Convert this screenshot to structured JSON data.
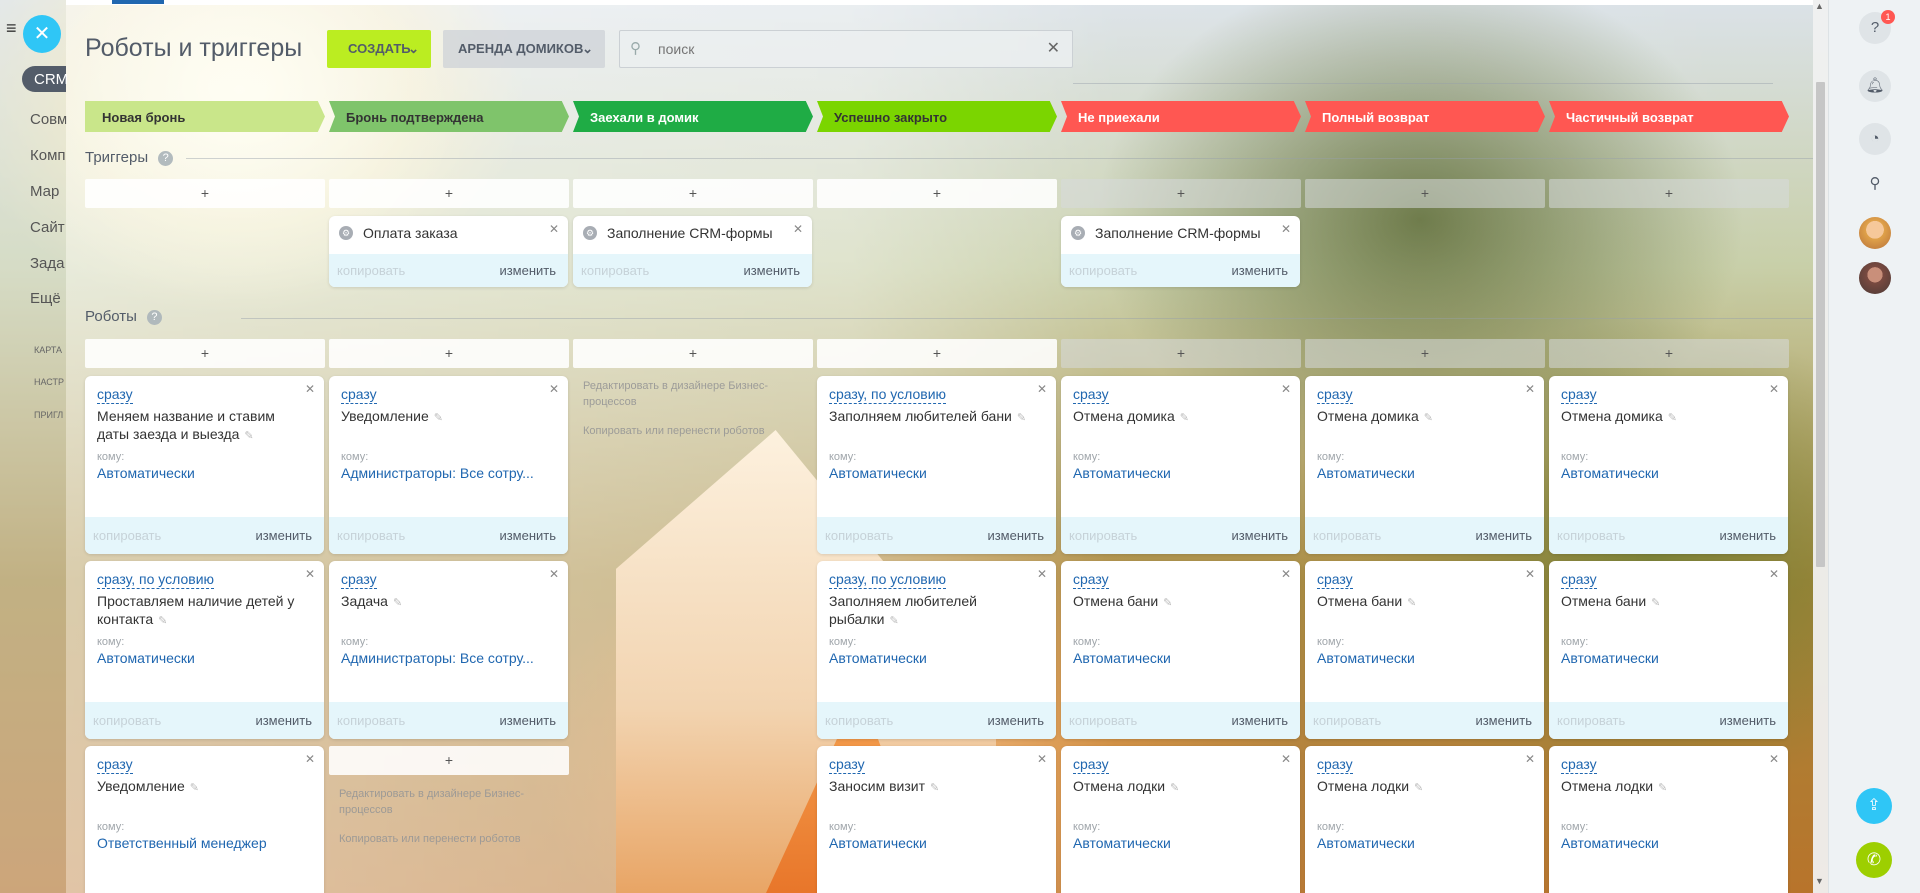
{
  "left_nav": {
    "crm": "CRM",
    "items": [
      "Совм",
      "Комп",
      "Мар",
      "Сайт",
      "Зада",
      "Ещё"
    ],
    "small": [
      "КАРТА",
      "НАСТР",
      "ПРИГЛ"
    ]
  },
  "close_label": "✕",
  "header": {
    "title": "Роботы и триггеры",
    "create_label": "СОЗДАТЬ",
    "pipeline_label": "АРЕНДА ДОМИКОВ",
    "search_placeholder": "поиск",
    "search_value": ""
  },
  "stages": [
    {
      "label": "Новая бронь",
      "color": "#c9e68a",
      "text": "#333333"
    },
    {
      "label": "Бронь подтверждена",
      "color": "#7fc46b",
      "text": "#333333"
    },
    {
      "label": "Заехали в домик",
      "color": "#1fac45",
      "text": "#ffffff"
    },
    {
      "label": "Успешно закрыто",
      "color": "#7bd500",
      "text": "#333333"
    },
    {
      "label": "Не приехали",
      "color": "#ff5752",
      "text": "#ffffff"
    },
    {
      "label": "Полный возврат",
      "color": "#ff5752",
      "text": "#ffffff"
    },
    {
      "label": "Частичный возврат",
      "color": "#ff5752",
      "text": "#ffffff"
    }
  ],
  "triggers": {
    "title": "Триггеры",
    "add_label": "+",
    "cards": [
      {
        "name": "Оплата заказа",
        "copy": "копировать",
        "edit": "изменить"
      },
      {
        "name": "Заполнение CRM-формы",
        "copy": "копировать",
        "edit": "изменить"
      },
      {
        "name": "Заполнение CRM-формы",
        "copy": "копировать",
        "edit": "изменить"
      }
    ]
  },
  "robots": {
    "title": "Роботы",
    "add_label": "+",
    "to_label": "кому:",
    "copy_label": "копировать",
    "edit_label": "изменить",
    "designer_text": "Редактировать в дизайнере Бизнес-процессов",
    "designer_text2": "Копировать или перенести роботов",
    "cards": [
      {
        "when": "сразу",
        "name": "Меняем название и ставим даты заезда и выезда",
        "resp": "Автоматически"
      },
      {
        "when": "сразу",
        "name": "Уведомление",
        "resp": "Администраторы: Все сотру..."
      },
      {
        "when": "сразу, по условию",
        "name": "Заполняем любителей бани",
        "resp": "Автоматически"
      },
      {
        "when": "сразу",
        "name": "Отмена домика",
        "resp": "Автоматически"
      },
      {
        "when": "сразу",
        "name": "Отмена домика",
        "resp": "Автоматически"
      },
      {
        "when": "сразу",
        "name": "Отмена домика",
        "resp": "Автоматически"
      },
      {
        "when": "сразу, по условию",
        "name": "Проставляем наличие детей у контакта",
        "resp": "Автоматически"
      },
      {
        "when": "сразу",
        "name": "Задача",
        "resp": "Администраторы: Все сотру..."
      },
      {
        "when": "сразу, по условию",
        "name": "Заполняем любителей рыбалки",
        "resp": "Автоматически"
      },
      {
        "when": "сразу",
        "name": "Отмена бани",
        "resp": "Автоматически"
      },
      {
        "when": "сразу",
        "name": "Отмена бани",
        "resp": "Автоматически"
      },
      {
        "when": "сразу",
        "name": "Отмена бани",
        "resp": "Автоматически"
      },
      {
        "when": "сразу",
        "name": "Уведомление",
        "resp": "Ответственный менеджер"
      },
      {
        "when": "сразу",
        "name": "Заносим визит",
        "resp": "Автоматически"
      },
      {
        "when": "сразу",
        "name": "Отмена лодки",
        "resp": "Автоматически"
      },
      {
        "when": "сразу",
        "name": "Отмена лодки",
        "resp": "Автоматически"
      },
      {
        "when": "сразу",
        "name": "Отмена лодки",
        "resp": "Автоматически"
      }
    ]
  },
  "right_panel": {
    "notification_count": "1",
    "icons": [
      "help-icon",
      "bell-icon",
      "chat-icon",
      "search-icon",
      "avatar",
      "avatar",
      "share-icon",
      "phone-icon"
    ]
  }
}
